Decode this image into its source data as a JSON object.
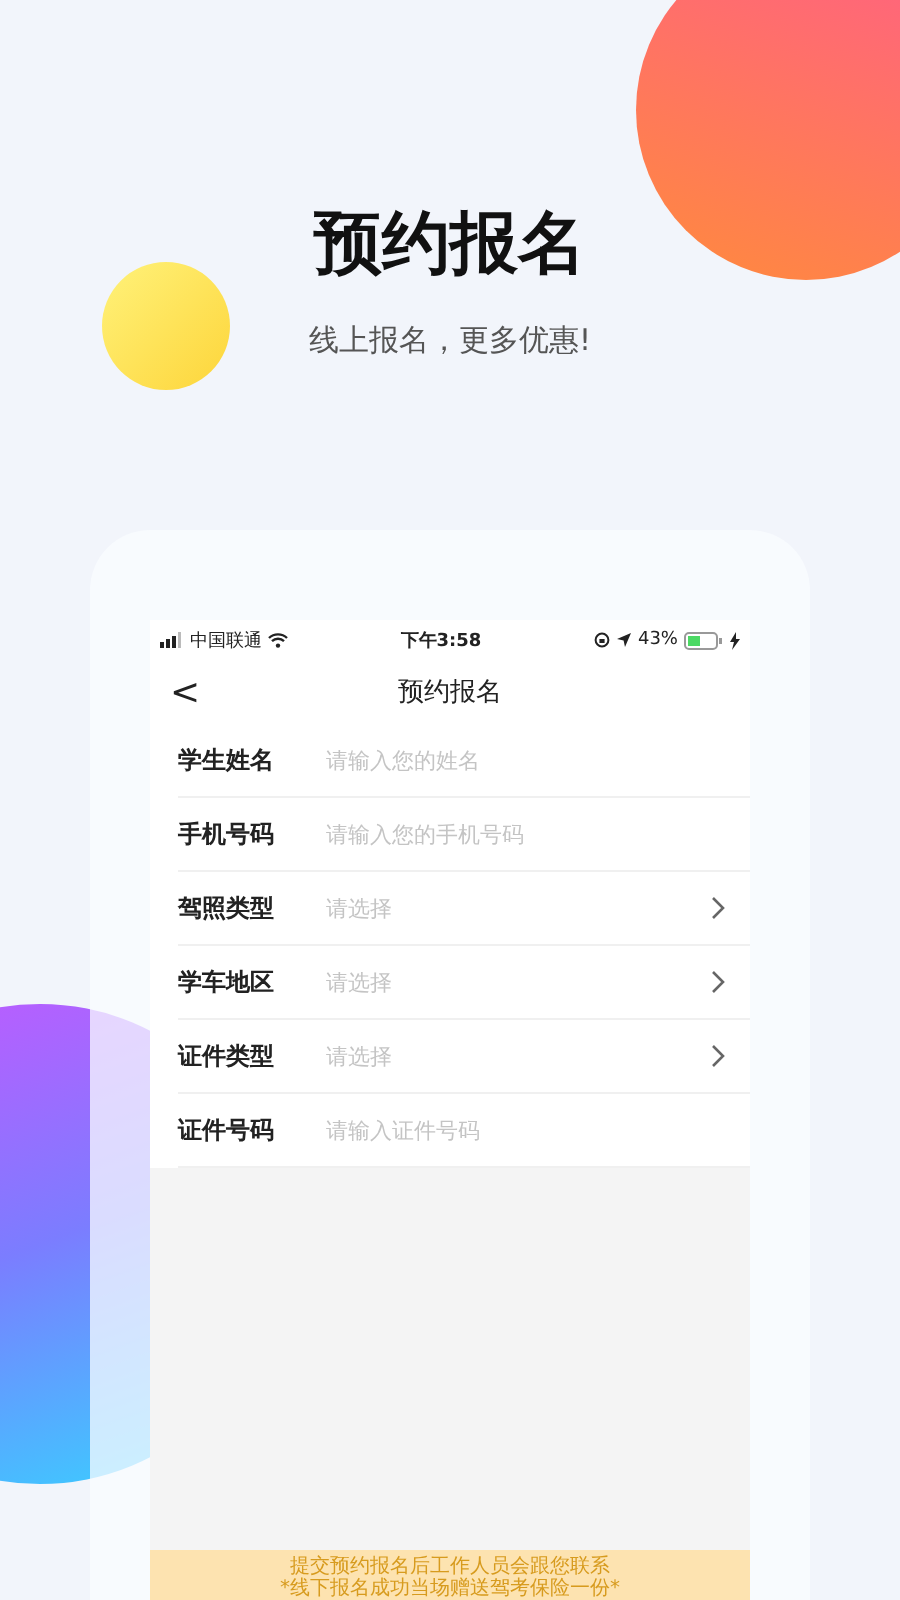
{
  "promo": {
    "title": "预约报名",
    "subtitle": "线上报名，更多优惠!"
  },
  "status_bar": {
    "carrier": "中国联通",
    "time": "下午3:58",
    "battery": "43%"
  },
  "nav": {
    "back": "<",
    "title": "预约报名"
  },
  "form": [
    {
      "kind": "input",
      "label": "学生姓名",
      "placeholder": "请输入您的姓名"
    },
    {
      "kind": "input",
      "label": "手机号码",
      "placeholder": "请输入您的手机号码"
    },
    {
      "kind": "select",
      "label": "驾照类型",
      "placeholder": "请选择"
    },
    {
      "kind": "select",
      "label": "学车地区",
      "placeholder": "请选择"
    },
    {
      "kind": "select",
      "label": "证件类型",
      "placeholder": "请选择"
    },
    {
      "kind": "input",
      "label": "证件号码",
      "placeholder": "请输入证件号码"
    }
  ],
  "notice": [
    "提交预约报名后工作人员会跟您联系",
    "*线下报名成功当场赠送驾考保险一份*"
  ]
}
